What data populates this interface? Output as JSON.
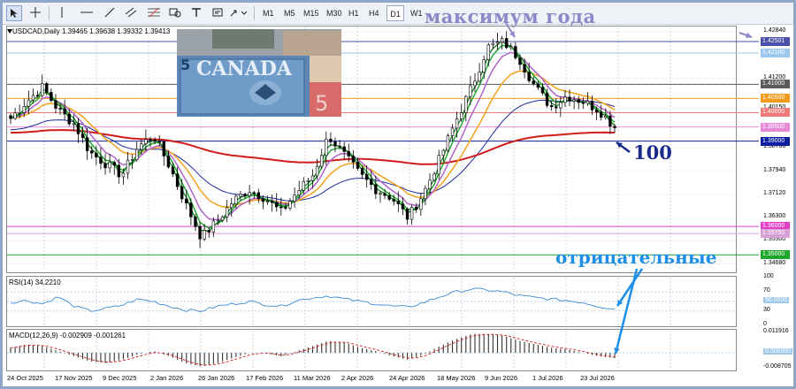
{
  "toolbar": {
    "timeframes": [
      "M1",
      "M5",
      "M15",
      "M30",
      "H1",
      "H4",
      "D1",
      "W1"
    ],
    "active_timeframe": "D1"
  },
  "annotations": {
    "year_max": "максимум года",
    "ma100": "100",
    "negative": "отрицательные"
  },
  "chart": {
    "symbol_line": "USDCAD,Daily  1.39465 1.39638 1.39332 1.39413",
    "photo_banknote_text": "CANADA"
  },
  "price_axis": {
    "ticks": [
      "1.42840",
      "1.41200",
      "1.40150",
      "1.38760",
      "1.37940",
      "1.37120",
      "1.36300",
      "1.35500",
      "1.34680"
    ],
    "boxes": [
      {
        "label": "1.42501",
        "color": "#4a4fa8"
      },
      {
        "label": "1.42100",
        "color": "#9cc8f0"
      },
      {
        "label": "1.41000",
        "color": "#5a5a5a"
      },
      {
        "label": "1.40500",
        "color": "#f29a1e"
      },
      {
        "label": "1.40000",
        "color": "#ef7a78"
      },
      {
        "label": "1.39500",
        "color": "#e58bd8"
      },
      {
        "label": "1.39000",
        "color": "#0c1fa0"
      },
      {
        "label": "1.36000",
        "color": "#e23fc9"
      },
      {
        "label": "1.35750",
        "color": "#d9a0d6"
      },
      {
        "label": "1.35000",
        "color": "#1ca62b"
      }
    ]
  },
  "rsi": {
    "label": "RSI(14) 34.2210",
    "ticks": [
      "100",
      "70",
      "50.0000",
      "30",
      "0"
    ]
  },
  "macd": {
    "label": "MACD(12,26,9) -0.002909 -0.001261",
    "ticks": [
      "0.011916",
      "0.000000",
      "-0.008705"
    ]
  },
  "dates": [
    "24 Oct 2025",
    "17 Nov 2025",
    "9 Dec 2025",
    "2 Jan 2026",
    "26 Jan 2026",
    "17 Feb 2026",
    "11 Mar 2026",
    "2 Apr 2026",
    "24 Apr 2026",
    "18 May 2026",
    "9 Jun 2026",
    "1 Jul 2026",
    "23 Jul 2026"
  ],
  "colors": {
    "ema_fast": "#0a7a18",
    "ema_mid": "#1ca62b",
    "ma_violet": "#b163c9",
    "ma_orange": "#f0a21e",
    "ma100": "#1f2c9a",
    "ma200": "#d11c1c",
    "candles": "#000000"
  },
  "chart_data": {
    "type": "candlestick",
    "title": "USDCAD,Daily",
    "ylim": [
      1.3445,
      1.43
    ],
    "x": [
      "24 Oct 2025",
      "17 Nov 2025",
      "9 Dec 2025",
      "2 Jan 2026",
      "26 Jan 2026",
      "17 Feb 2026",
      "11 Mar 2026",
      "2 Apr 2026",
      "24 Apr 2026",
      "18 May 2026",
      "9 Jun 2026",
      "1 Jul 2026",
      "23 Jul 2026"
    ],
    "close_path": [
      1.398,
      1.404,
      1.409,
      1.401,
      1.396,
      1.386,
      1.382,
      1.378,
      1.388,
      1.392,
      1.381,
      1.368,
      1.356,
      1.362,
      1.369,
      1.373,
      1.37,
      1.365,
      1.372,
      1.378,
      1.392,
      1.385,
      1.378,
      1.373,
      1.37,
      1.363,
      1.372,
      1.384,
      1.397,
      1.409,
      1.423,
      1.425,
      1.419,
      1.409,
      1.402,
      1.406,
      1.404,
      1.401,
      1.395
    ],
    "rsi": [
      48,
      52,
      45,
      60,
      40,
      30,
      35,
      42,
      55,
      50,
      40,
      32,
      30,
      40,
      45,
      50,
      44,
      40,
      52,
      58,
      62,
      55,
      50,
      45,
      40,
      38,
      48,
      60,
      70,
      76,
      74,
      70,
      62,
      58,
      55,
      52,
      48,
      40,
      34
    ],
    "macd": [
      0.003,
      0.005,
      0.004,
      0.001,
      -0.002,
      -0.005,
      -0.006,
      -0.004,
      -0.001,
      0.001,
      -0.002,
      -0.006,
      -0.008,
      -0.006,
      -0.003,
      0.0,
      0.0,
      -0.002,
      0.001,
      0.004,
      0.007,
      0.006,
      0.003,
      0.001,
      -0.002,
      -0.004,
      -0.001,
      0.004,
      0.008,
      0.011,
      0.011,
      0.01,
      0.007,
      0.005,
      0.003,
      0.002,
      0.0,
      -0.002,
      -0.003
    ]
  }
}
